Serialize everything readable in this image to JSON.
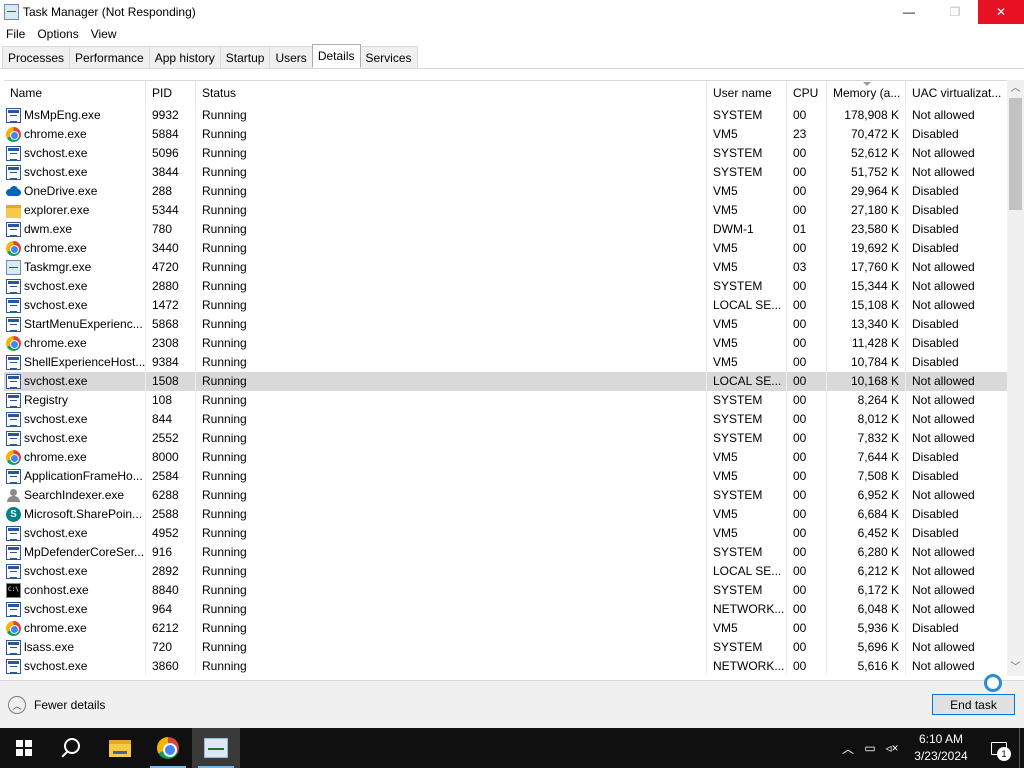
{
  "window": {
    "title": "Task Manager (Not Responding)",
    "minimize": "—",
    "maximize": "❐",
    "close": "✕"
  },
  "menu": [
    "File",
    "Options",
    "View"
  ],
  "tabs": [
    {
      "label": "Processes",
      "active": false
    },
    {
      "label": "Performance",
      "active": false
    },
    {
      "label": "App history",
      "active": false
    },
    {
      "label": "Startup",
      "active": false
    },
    {
      "label": "Users",
      "active": false
    },
    {
      "label": "Details",
      "active": true
    },
    {
      "label": "Services",
      "active": false
    }
  ],
  "columns": {
    "name": "Name",
    "pid": "PID",
    "status": "Status",
    "user": "User name",
    "cpu": "CPU",
    "memory": "Memory (a...",
    "uac": "UAC virtualizat..."
  },
  "rows": [
    {
      "icon": "exe",
      "name": "MsMpEng.exe",
      "pid": "9932",
      "status": "Running",
      "user": "SYSTEM",
      "cpu": "00",
      "mem": "178,908 K",
      "uac": "Not allowed"
    },
    {
      "icon": "chrome",
      "name": "chrome.exe",
      "pid": "5884",
      "status": "Running",
      "user": "VM5",
      "cpu": "23",
      "mem": "70,472 K",
      "uac": "Disabled"
    },
    {
      "icon": "exe",
      "name": "svchost.exe",
      "pid": "5096",
      "status": "Running",
      "user": "SYSTEM",
      "cpu": "00",
      "mem": "52,612 K",
      "uac": "Not allowed"
    },
    {
      "icon": "exe",
      "name": "svchost.exe",
      "pid": "3844",
      "status": "Running",
      "user": "SYSTEM",
      "cpu": "00",
      "mem": "51,752 K",
      "uac": "Not allowed"
    },
    {
      "icon": "onedrive",
      "name": "OneDrive.exe",
      "pid": "288",
      "status": "Running",
      "user": "VM5",
      "cpu": "00",
      "mem": "29,964 K",
      "uac": "Disabled"
    },
    {
      "icon": "folder",
      "name": "explorer.exe",
      "pid": "5344",
      "status": "Running",
      "user": "VM5",
      "cpu": "00",
      "mem": "27,180 K",
      "uac": "Disabled"
    },
    {
      "icon": "exe",
      "name": "dwm.exe",
      "pid": "780",
      "status": "Running",
      "user": "DWM-1",
      "cpu": "01",
      "mem": "23,580 K",
      "uac": "Disabled"
    },
    {
      "icon": "chrome",
      "name": "chrome.exe",
      "pid": "3440",
      "status": "Running",
      "user": "VM5",
      "cpu": "00",
      "mem": "19,692 K",
      "uac": "Disabled"
    },
    {
      "icon": "taskmgr",
      "name": "Taskmgr.exe",
      "pid": "4720",
      "status": "Running",
      "user": "VM5",
      "cpu": "03",
      "mem": "17,760 K",
      "uac": "Not allowed"
    },
    {
      "icon": "exe",
      "name": "svchost.exe",
      "pid": "2880",
      "status": "Running",
      "user": "SYSTEM",
      "cpu": "00",
      "mem": "15,344 K",
      "uac": "Not allowed"
    },
    {
      "icon": "exe",
      "name": "svchost.exe",
      "pid": "1472",
      "status": "Running",
      "user": "LOCAL SE...",
      "cpu": "00",
      "mem": "15,108 K",
      "uac": "Not allowed"
    },
    {
      "icon": "exe",
      "name": "StartMenuExperienc...",
      "pid": "5868",
      "status": "Running",
      "user": "VM5",
      "cpu": "00",
      "mem": "13,340 K",
      "uac": "Disabled"
    },
    {
      "icon": "chrome",
      "name": "chrome.exe",
      "pid": "2308",
      "status": "Running",
      "user": "VM5",
      "cpu": "00",
      "mem": "11,428 K",
      "uac": "Disabled"
    },
    {
      "icon": "exe",
      "name": "ShellExperienceHost....",
      "pid": "9384",
      "status": "Running",
      "user": "VM5",
      "cpu": "00",
      "mem": "10,784 K",
      "uac": "Disabled"
    },
    {
      "icon": "exe",
      "name": "svchost.exe",
      "pid": "1508",
      "status": "Running",
      "user": "LOCAL SE...",
      "cpu": "00",
      "mem": "10,168 K",
      "uac": "Not allowed",
      "selected": true
    },
    {
      "icon": "exe",
      "name": "Registry",
      "pid": "108",
      "status": "Running",
      "user": "SYSTEM",
      "cpu": "00",
      "mem": "8,264 K",
      "uac": "Not allowed"
    },
    {
      "icon": "exe",
      "name": "svchost.exe",
      "pid": "844",
      "status": "Running",
      "user": "SYSTEM",
      "cpu": "00",
      "mem": "8,012 K",
      "uac": "Not allowed"
    },
    {
      "icon": "exe",
      "name": "svchost.exe",
      "pid": "2552",
      "status": "Running",
      "user": "SYSTEM",
      "cpu": "00",
      "mem": "7,832 K",
      "uac": "Not allowed"
    },
    {
      "icon": "chrome",
      "name": "chrome.exe",
      "pid": "8000",
      "status": "Running",
      "user": "VM5",
      "cpu": "00",
      "mem": "7,644 K",
      "uac": "Disabled"
    },
    {
      "icon": "exe",
      "name": "ApplicationFrameHo...",
      "pid": "2584",
      "status": "Running",
      "user": "VM5",
      "cpu": "00",
      "mem": "7,508 K",
      "uac": "Disabled"
    },
    {
      "icon": "searcher",
      "name": "SearchIndexer.exe",
      "pid": "6288",
      "status": "Running",
      "user": "SYSTEM",
      "cpu": "00",
      "mem": "6,952 K",
      "uac": "Not allowed"
    },
    {
      "icon": "sharepoint",
      "name": "Microsoft.SharePoin...",
      "pid": "2588",
      "status": "Running",
      "user": "VM5",
      "cpu": "00",
      "mem": "6,684 K",
      "uac": "Disabled"
    },
    {
      "icon": "exe",
      "name": "svchost.exe",
      "pid": "4952",
      "status": "Running",
      "user": "VM5",
      "cpu": "00",
      "mem": "6,452 K",
      "uac": "Disabled"
    },
    {
      "icon": "exe",
      "name": "MpDefenderCoreSer...",
      "pid": "916",
      "status": "Running",
      "user": "SYSTEM",
      "cpu": "00",
      "mem": "6,280 K",
      "uac": "Not allowed"
    },
    {
      "icon": "exe",
      "name": "svchost.exe",
      "pid": "2892",
      "status": "Running",
      "user": "LOCAL SE...",
      "cpu": "00",
      "mem": "6,212 K",
      "uac": "Not allowed"
    },
    {
      "icon": "conhost",
      "name": "conhost.exe",
      "pid": "8840",
      "status": "Running",
      "user": "SYSTEM",
      "cpu": "00",
      "mem": "6,172 K",
      "uac": "Not allowed"
    },
    {
      "icon": "exe",
      "name": "svchost.exe",
      "pid": "964",
      "status": "Running",
      "user": "NETWORK...",
      "cpu": "00",
      "mem": "6,048 K",
      "uac": "Not allowed"
    },
    {
      "icon": "chrome",
      "name": "chrome.exe",
      "pid": "6212",
      "status": "Running",
      "user": "VM5",
      "cpu": "00",
      "mem": "5,936 K",
      "uac": "Disabled"
    },
    {
      "icon": "exe",
      "name": "lsass.exe",
      "pid": "720",
      "status": "Running",
      "user": "SYSTEM",
      "cpu": "00",
      "mem": "5,696 K",
      "uac": "Not allowed"
    },
    {
      "icon": "exe",
      "name": "svchost.exe",
      "pid": "3860",
      "status": "Running",
      "user": "NETWORK...",
      "cpu": "00",
      "mem": "5,616 K",
      "uac": "Not allowed"
    }
  ],
  "footer": {
    "fewer_details": "Fewer details",
    "end_task": "End task"
  },
  "taskbar": {
    "time": "6:10 AM",
    "date": "3/23/2024",
    "notification_count": "1"
  },
  "colors": {
    "close_button": "#e81123",
    "selected_row": "#d9d9d9",
    "taskbar": "#101010",
    "accent": "#0078d7"
  }
}
